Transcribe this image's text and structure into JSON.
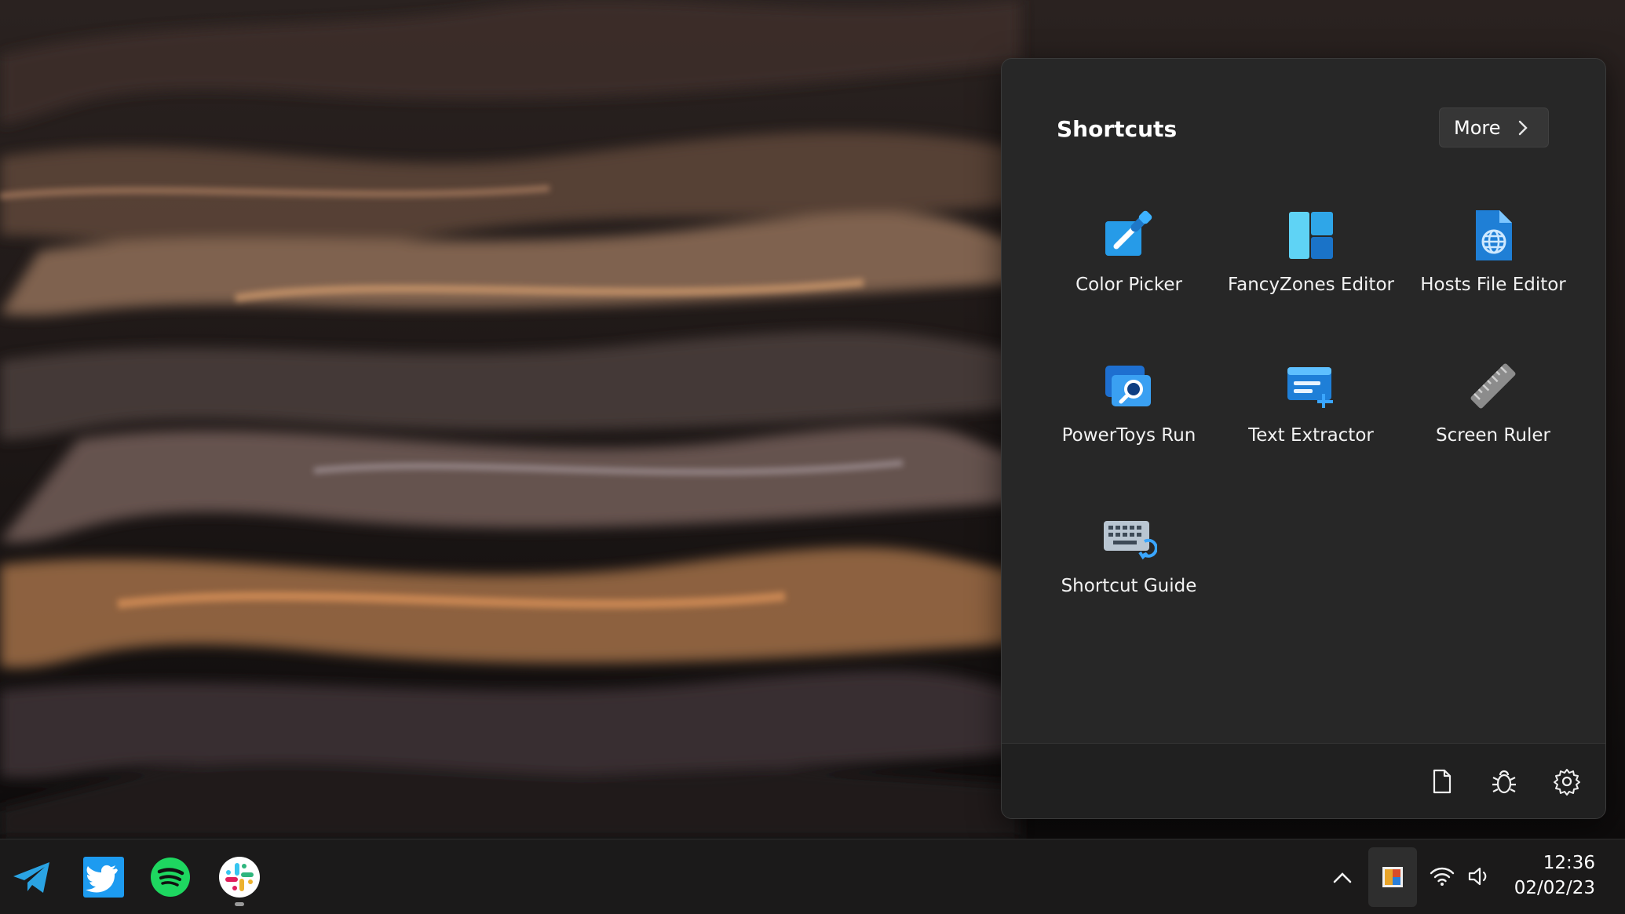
{
  "flyout": {
    "title": "Shortcuts",
    "more_label": "More",
    "tiles": [
      {
        "label": "Color Picker",
        "icon": "color-picker-icon"
      },
      {
        "label": "FancyZones Editor",
        "icon": "fancyzones-icon"
      },
      {
        "label": "Hosts File Editor",
        "icon": "hosts-file-icon"
      },
      {
        "label": "PowerToys Run",
        "icon": "powertoys-run-icon"
      },
      {
        "label": "Text Extractor",
        "icon": "text-extractor-icon"
      },
      {
        "label": "Screen Ruler",
        "icon": "ruler-icon"
      },
      {
        "label": "Shortcut Guide",
        "icon": "keyboard-icon"
      }
    ],
    "footer_icons": [
      "document-icon",
      "bug-icon",
      "gear-icon"
    ]
  },
  "taskbar": {
    "apps": [
      "telegram-icon",
      "twitter-icon",
      "spotify-icon",
      "slack-icon"
    ],
    "tray_icons": [
      "chevron-up-icon",
      "powertoys-tray-icon",
      "wifi-icon",
      "volume-icon"
    ],
    "time": "12:36",
    "date": "02/02/23"
  },
  "colors": {
    "accent": "#2b9af3",
    "flyout_bg": "#272727",
    "taskbar_bg": "#1b1a1a"
  }
}
